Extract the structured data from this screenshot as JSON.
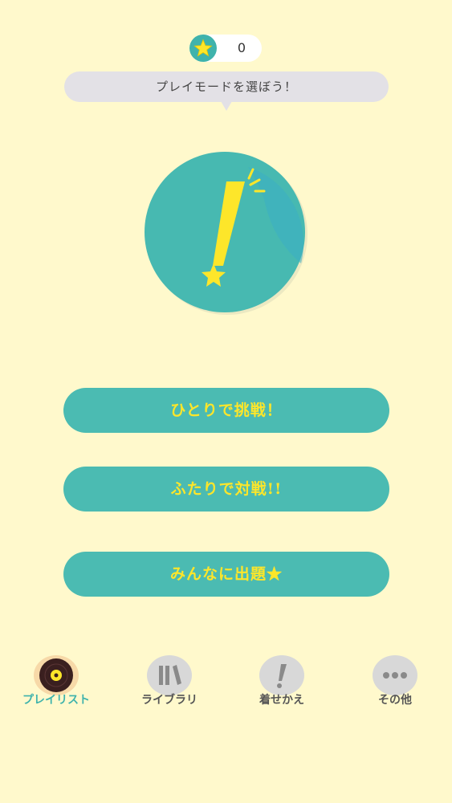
{
  "header": {
    "coin_count": "0",
    "icons": {
      "coin": "star-icon"
    }
  },
  "prompt": {
    "text": "プレイモードを選ぼう！"
  },
  "hero": {
    "icon": "exclamation-star-icon"
  },
  "modes": [
    {
      "label": "ひとりで挑戦！"
    },
    {
      "label": "ふたりで対戦!!"
    },
    {
      "label": "みんなに出題★"
    }
  ],
  "nav": {
    "active": "playlist",
    "items": [
      {
        "id": "playlist",
        "label": "プレイリスト",
        "icon": "record-icon"
      },
      {
        "id": "library",
        "label": "ライブラリ",
        "icon": "books-icon"
      },
      {
        "id": "dressup",
        "label": "着せかえ",
        "icon": "exclamation-icon"
      },
      {
        "id": "other",
        "label": "その他",
        "icon": "dots-icon"
      }
    ]
  },
  "colors": {
    "background": "#fff9cc",
    "accent": "#4bbbb2",
    "button_text": "#fde62a",
    "bubble": "#e3e1e6"
  }
}
